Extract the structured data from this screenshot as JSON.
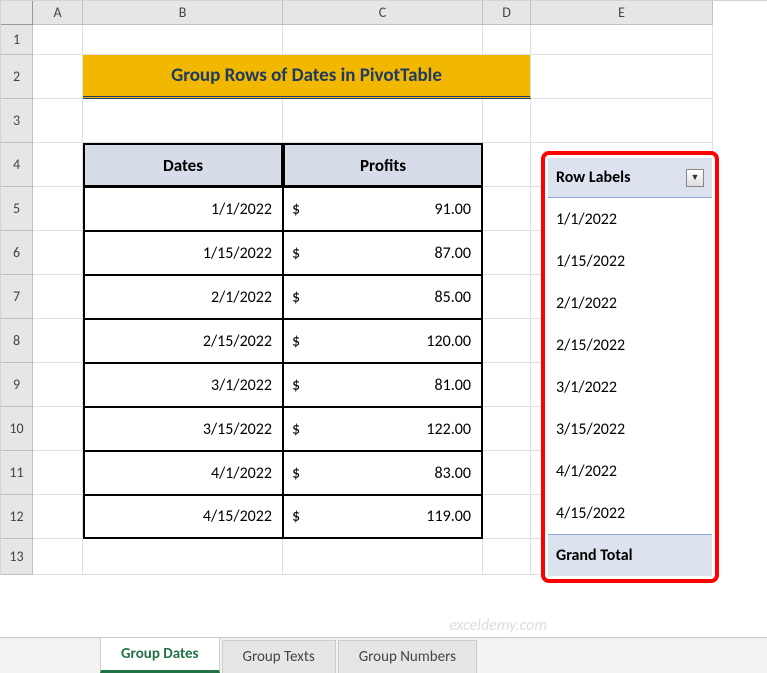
{
  "columns": [
    "A",
    "B",
    "C",
    "D",
    "E"
  ],
  "rows": [
    "1",
    "2",
    "3",
    "4",
    "5",
    "6",
    "7",
    "8",
    "9",
    "10",
    "11",
    "12",
    "13"
  ],
  "title": "Group Rows of Dates in PivotTable",
  "table": {
    "headers": {
      "dates": "Dates",
      "profits": "Profits"
    },
    "currency": "$",
    "rows": [
      {
        "date": "1/1/2022",
        "profit": "91.00"
      },
      {
        "date": "1/15/2022",
        "profit": "87.00"
      },
      {
        "date": "2/1/2022",
        "profit": "85.00"
      },
      {
        "date": "2/15/2022",
        "profit": "120.00"
      },
      {
        "date": "3/1/2022",
        "profit": "81.00"
      },
      {
        "date": "3/15/2022",
        "profit": "122.00"
      },
      {
        "date": "4/1/2022",
        "profit": "83.00"
      },
      {
        "date": "4/15/2022",
        "profit": "119.00"
      }
    ]
  },
  "pivot": {
    "header": "Row Labels",
    "rows": [
      "1/1/2022",
      "1/15/2022",
      "2/1/2022",
      "2/15/2022",
      "3/1/2022",
      "3/15/2022",
      "4/1/2022",
      "4/15/2022"
    ],
    "total": "Grand Total"
  },
  "sheets": {
    "active": "Group Dates",
    "others": [
      "Group Texts",
      "Group Numbers"
    ]
  },
  "watermark": "exceldemy.com"
}
